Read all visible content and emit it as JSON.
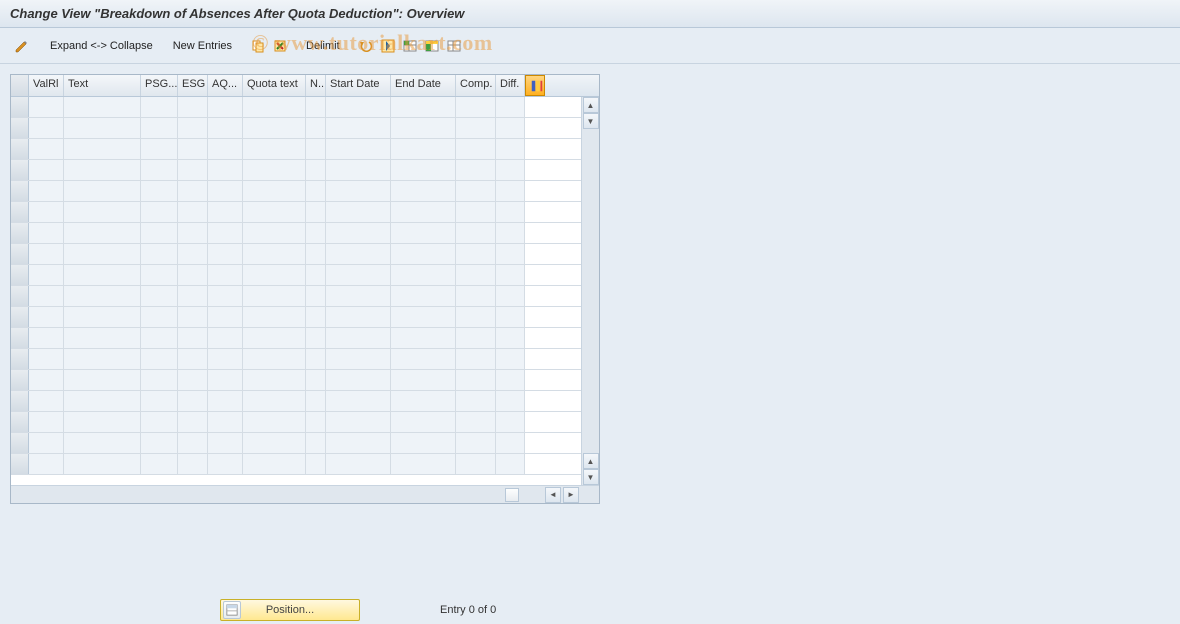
{
  "title": "Change View \"Breakdown of Absences After Quota Deduction\": Overview",
  "toolbar": {
    "expand_collapse": "Expand <-> Collapse",
    "new_entries": "New Entries",
    "delimit": "Delimit"
  },
  "table": {
    "columns": {
      "valrl": "ValRl",
      "text": "Text",
      "psg": "PSG...",
      "esg": "ESG",
      "aq": "AQ...",
      "quota_text": "Quota text",
      "n": "N..",
      "start_date": "Start Date",
      "end_date": "End Date",
      "comp": "Comp.",
      "diff": "Diff."
    },
    "rows": [
      {},
      {},
      {},
      {},
      {},
      {},
      {},
      {},
      {},
      {},
      {},
      {},
      {},
      {},
      {},
      {},
      {},
      {}
    ]
  },
  "footer": {
    "position_label": "Position...",
    "entry_status": "Entry 0 of 0"
  },
  "watermark": "© www.tutorialkart.com"
}
